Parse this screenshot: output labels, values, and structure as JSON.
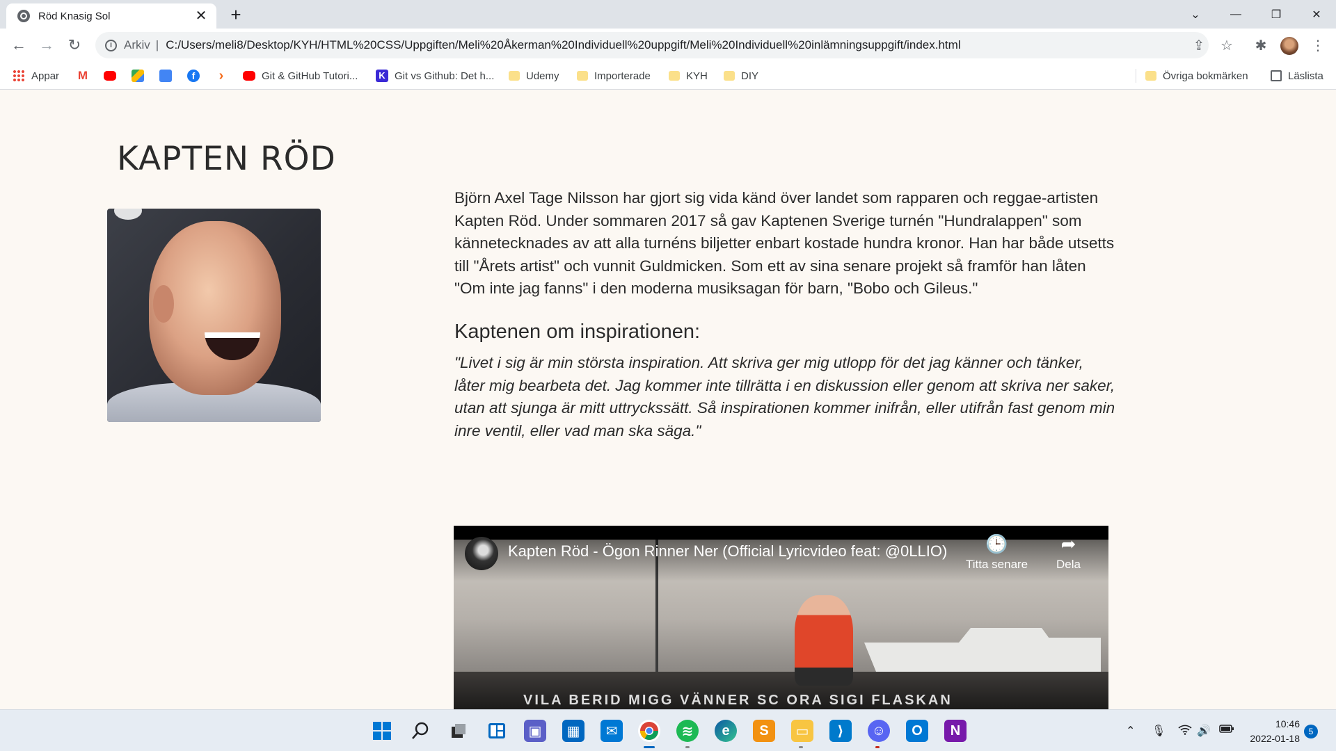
{
  "browser": {
    "tab_title": "Röd Knasig Sol",
    "tab_close": "✕",
    "new_tab": "+",
    "window_controls": {
      "dropdown": "⌄",
      "minimize": "—",
      "restore": "❐",
      "close": "✕"
    },
    "nav": {
      "back": "←",
      "forward": "→",
      "reload": "↻"
    },
    "address": {
      "info": "i",
      "scheme_label": "Arkiv",
      "separator": "|",
      "url": "C:/Users/meli8/Desktop/KYH/HTML%20CSS/Uppgiften/Meli%20Åkerman%20Individuell%20uppgift/Meli%20Individuell%20inlämningsuppgift/index.html"
    },
    "toolbar_icons": {
      "share": "⇪",
      "star": "☆",
      "extensions": "✱",
      "menu": "⋮"
    }
  },
  "bookmarks": {
    "items": [
      {
        "label": "Appar",
        "icon": "apps-grid-icon"
      },
      {
        "label": "",
        "icon": "gmail-icon"
      },
      {
        "label": "",
        "icon": "youtube-icon"
      },
      {
        "label": "",
        "icon": "maps-icon"
      },
      {
        "label": "",
        "icon": "translate-icon"
      },
      {
        "label": "",
        "icon": "facebook-icon"
      },
      {
        "label": "",
        "icon": "chevron-icon"
      },
      {
        "label": "Git & GitHub Tutori...",
        "icon": "youtube-icon"
      },
      {
        "label": "Git vs Github: Det h...",
        "icon": "k-icon"
      },
      {
        "label": "Udemy",
        "icon": "folder-icon"
      },
      {
        "label": "Importerade",
        "icon": "folder-icon"
      },
      {
        "label": "KYH",
        "icon": "folder-icon"
      },
      {
        "label": "DIY",
        "icon": "folder-icon"
      }
    ],
    "other": "Övriga bokmärken",
    "reading_list": "Läslista"
  },
  "page": {
    "title": "KAPTEN RÖD",
    "bio": "Björn Axel Tage Nilsson har gjort sig vida känd över landet som rapparen och reggae-artisten Kapten Röd. Under sommaren 2017 så gav Kaptenen Sverige turnén \"Hundralappen\" som kännetecknades av att alla turnéns biljetter enbart kostade hundra kronor. Han har både utsetts till \"Årets artist\" och vunnit Guldmicken. Som ett av sina senare projekt så framför han låten \"Om inte jag fanns\" i den moderna musiksagan för barn, \"Bobo och Gileus.\"",
    "inspiration_heading": "Kaptenen om inspirationen:",
    "quote": "\"Livet i sig är min största inspiration. Att skriva ger mig utlopp för det jag känner och tänker, låter mig bearbeta det. Jag kommer inte tillrätta i en diskussion eller genom att skriva ner saker, utan att sjunga är mitt uttryckssätt. Så inspirationen kommer inifrån, eller utifrån fast genom min inre ventil, eller vad man ska säga.\"",
    "video": {
      "title": "Kapten Röd - Ögon Rinner Ner (Official Lyricvideo feat: @0LLIO)",
      "watch_later": "Titta senare",
      "share": "Dela",
      "graffiti": "VILA BERID MIGG VÄNNER SC ORA SIGI FLASKAN"
    }
  },
  "taskbar": {
    "clock_time": "10:46",
    "clock_date": "2022-01-18",
    "notification_count": "5"
  },
  "colors": {
    "page_bg": "#fcf8f3",
    "tabstrip_bg": "#dfe3e8",
    "text": "#2b2b2b",
    "accent": "#0067c0"
  }
}
